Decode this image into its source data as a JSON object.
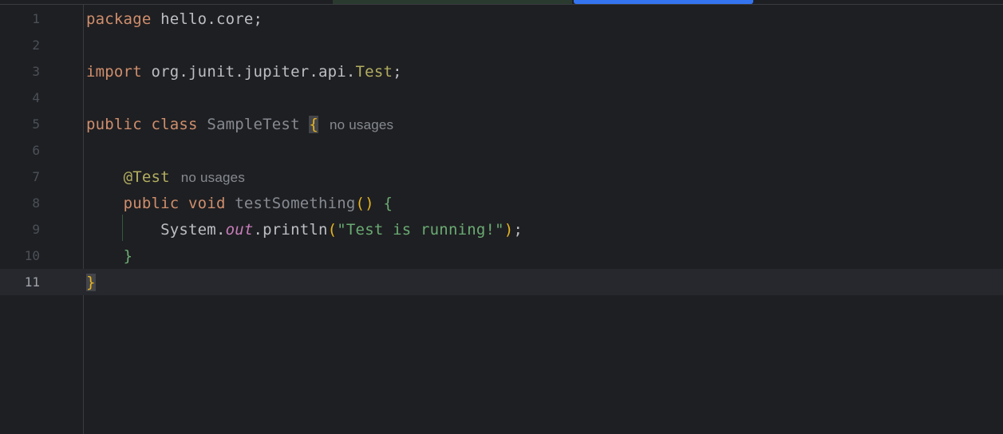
{
  "editor": {
    "colors": {
      "background": "#1e1f22",
      "keyword": "#cf8e6d",
      "annotation": "#b3ae60",
      "string": "#6aab73",
      "field": "#c77dbb",
      "tab_indicator_active": "#3574f0",
      "tab_indicator_inactive": "#2b3a2f"
    },
    "current_line": 11,
    "lines": [
      {
        "num": "1",
        "t1": "package",
        "t2": " hello.core;"
      },
      {
        "num": "2"
      },
      {
        "num": "3",
        "t1": "import",
        "t2": " org.junit.jupiter.api.",
        "t3": "Test",
        "t4": ";"
      },
      {
        "num": "4"
      },
      {
        "num": "5",
        "t1": "public class",
        "t2": " ",
        "t3": "SampleTest",
        "t4": " ",
        "t5": "{",
        "hint": "no usages"
      },
      {
        "num": "6"
      },
      {
        "num": "7",
        "t1": "    ",
        "t2": "@Test",
        "hint": "no usages"
      },
      {
        "num": "8",
        "t1": "    ",
        "t2": "public void",
        "t3": " ",
        "t4": "testSomething",
        "t5": "()",
        "t6": " ",
        "t7": "{"
      },
      {
        "num": "9",
        "t1": "        System.",
        "t2": "out",
        "t3": ".println",
        "t4": "(",
        "t5": "\"Test is running!\"",
        "t6": ")",
        "t7": ";"
      },
      {
        "num": "10",
        "t1": "    ",
        "t2": "}"
      },
      {
        "num": "11",
        "t1": "}"
      }
    ]
  }
}
